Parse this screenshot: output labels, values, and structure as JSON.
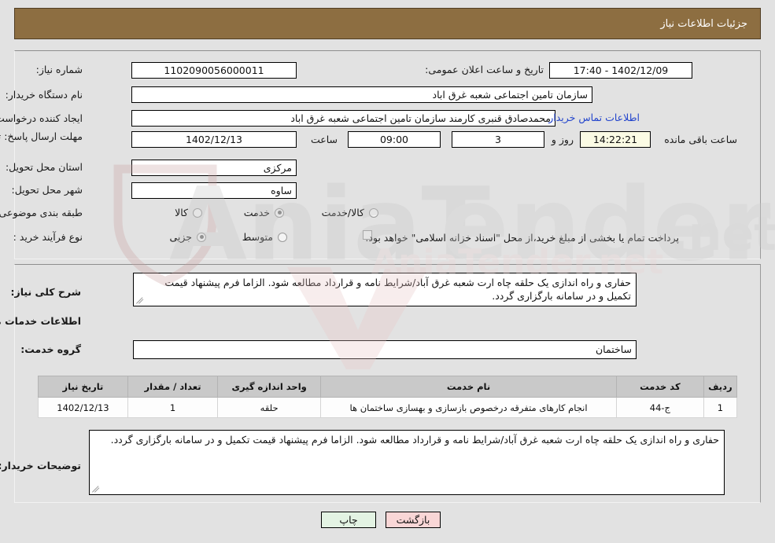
{
  "header": {
    "title": "جزئیات اطلاعات نیاز"
  },
  "top_panel": {
    "need_number_label": "شماره نیاز:",
    "need_number_value": "1102090056000011",
    "announce_datetime_label": "تاریخ و ساعت اعلان عمومی:",
    "announce_datetime_value": "1402/12/09 - 17:40",
    "buyer_org_label": "نام دستگاه خریدار:",
    "buyer_org_value": "سازمان تامین اجتماعی شعبه غرق اباد",
    "request_creator_label": "ایجاد کننده درخواست:",
    "request_creator_value": "محمدصادق قنبری کارمند سازمان تامین اجتماعی شعبه غرق اباد",
    "buyer_contact_link": "اطلاعات تماس خریدار",
    "deadline_label": "مهلت ارسال پاسخ: تا تاریخ:",
    "deadline_date": "1402/12/13",
    "time_label": "ساعت",
    "deadline_time": "09:00",
    "days_remaining": "3",
    "days_word": "روز و",
    "countdown": "14:22:21",
    "remaining_suffix": "ساعت باقی مانده",
    "province_label": "استان محل تحویل:",
    "province_value": "مرکزی",
    "city_label": "شهر محل تحویل:",
    "city_value": "ساوه",
    "category_label": "طبقه بندی موضوعی:",
    "category_options": [
      {
        "label": "کالا",
        "selected": false
      },
      {
        "label": "خدمت",
        "selected": true
      },
      {
        "label": "کالا/خدمت",
        "selected": false
      }
    ],
    "process_label": "نوع فرآیند خرید :",
    "process_options": [
      {
        "label": "جزیی",
        "selected": true
      },
      {
        "label": "متوسط",
        "selected": false
      }
    ],
    "treasury_checkbox_checked": false,
    "treasury_text": "پرداخت تمام یا بخشی از مبلغ خرید،از محل \"اسناد خزانه اسلامی\" خواهد بود."
  },
  "bottom_panel": {
    "general_desc_label": "شرح کلی نیاز:",
    "general_desc_value": "حفاری و راه اندازی یک حلقه چاه ارت شعبه غرق آباد/شرایط نامه و قرارداد مطالعه شود. الزاما فرم پیشنهاد قیمت تکمیل و در سامانه بارگزاری گردد.",
    "services_info_title": "اطلاعات خدمات مورد نیاز",
    "service_group_label": "گروه خدمت:",
    "service_group_value": "ساختمان",
    "table": {
      "columns": [
        "ردیف",
        "کد خدمت",
        "نام خدمت",
        "واحد اندازه گیری",
        "تعداد / مقدار",
        "تاریخ نیاز"
      ],
      "rows": [
        {
          "row_no": "1",
          "service_code": "ج-44",
          "service_name": "انجام کارهای متفرقه درخصوص بازسازی و بهسازی ساختمان ها",
          "unit": "حلقه",
          "quantity": "1",
          "need_date": "1402/12/13"
        }
      ]
    },
    "buyer_notes_label": "توضیحات خریدار:",
    "buyer_notes_value": "حفاری و راه اندازی یک حلقه چاه ارت شعبه غرق آباد/شرایط نامه و قرارداد مطالعه شود. الزاما فرم پیشنهاد قیمت تکمیل و در سامانه بارگزاری گردد."
  },
  "footer": {
    "back_button": "بازگشت",
    "print_button": "چاپ"
  },
  "colors": {
    "header_bar": "#8d6e41",
    "page_background": "#e2e2e2",
    "link": "#2244cc",
    "back_button": "#f9d6d6",
    "print_button": "#e3f3e3",
    "table_header": "#c9c9c9",
    "countdown_field": "#fbfbe4"
  }
}
